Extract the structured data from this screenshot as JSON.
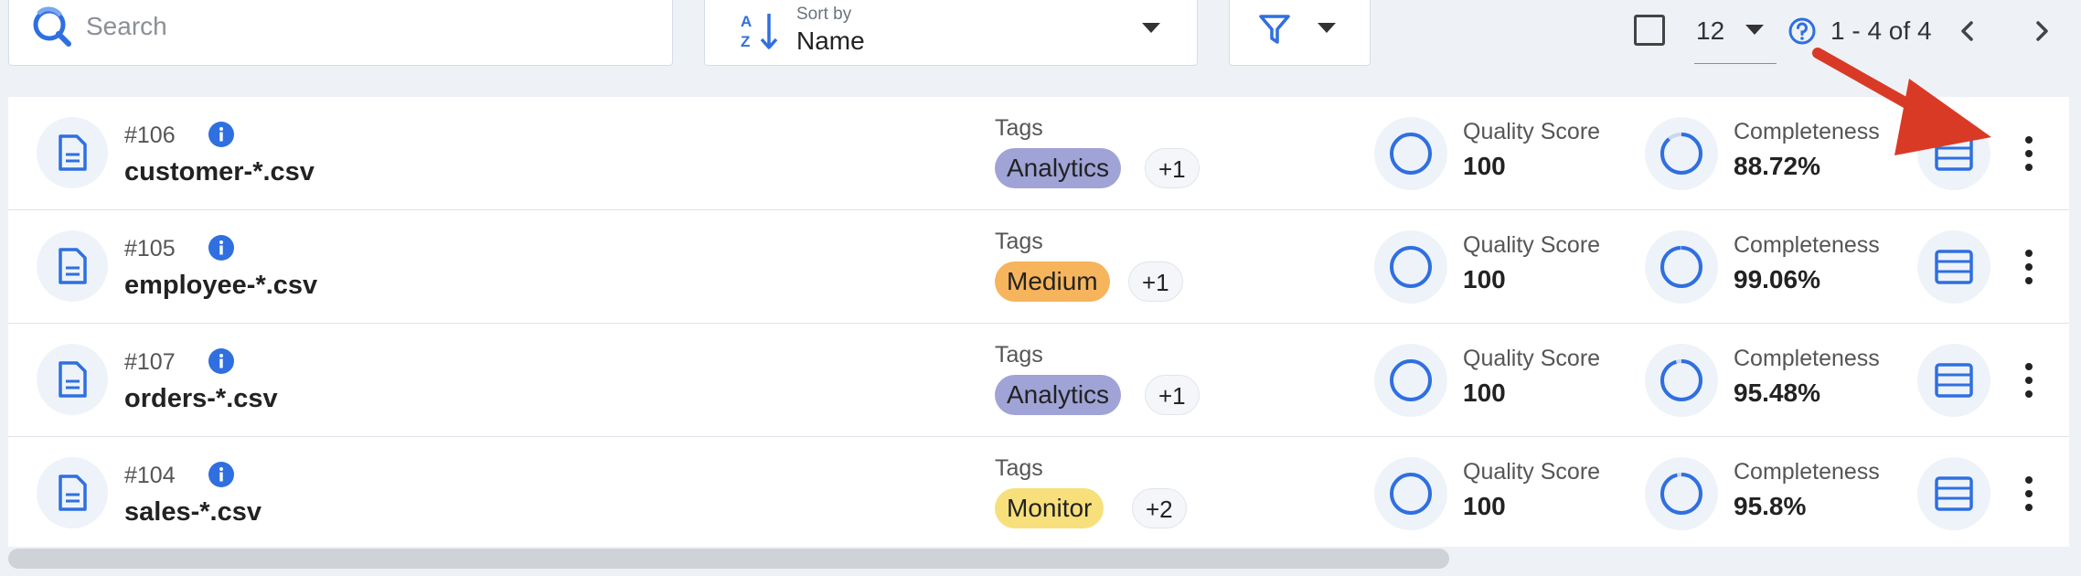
{
  "toolbar": {
    "search_placeholder": "Search",
    "sort_caption": "Sort by",
    "sort_value": "Name",
    "per_page": "12",
    "page_range": "1 - 4 of 4"
  },
  "rows": [
    {
      "id": "#106",
      "name": "customer-*.csv",
      "tags_label": "Tags",
      "tag": "Analytics",
      "tag_color": "#9fa3d6",
      "extra_tags": "+1",
      "quality_label": "Quality Score",
      "quality": "100",
      "completeness_label": "Completeness",
      "completeness": "88.72%"
    },
    {
      "id": "#105",
      "name": "employee-*.csv",
      "tags_label": "Tags",
      "tag": "Medium",
      "tag_color": "#f6b45c",
      "extra_tags": "+1",
      "quality_label": "Quality Score",
      "quality": "100",
      "completeness_label": "Completeness",
      "completeness": "99.06%"
    },
    {
      "id": "#107",
      "name": "orders-*.csv",
      "tags_label": "Tags",
      "tag": "Analytics",
      "tag_color": "#9fa3d6",
      "extra_tags": "+1",
      "quality_label": "Quality Score",
      "quality": "100",
      "completeness_label": "Completeness",
      "completeness": "95.48%"
    },
    {
      "id": "#104",
      "name": "sales-*.csv",
      "tags_label": "Tags",
      "tag": "Monitor",
      "tag_color": "#f7e07c",
      "extra_tags": "+2",
      "quality_label": "Quality Score",
      "quality": "100",
      "completeness_label": "Completeness",
      "completeness": "95.8%"
    }
  ],
  "colors": {
    "accent": "#2f6fe0",
    "annotation_arrow": "#d93a26"
  }
}
